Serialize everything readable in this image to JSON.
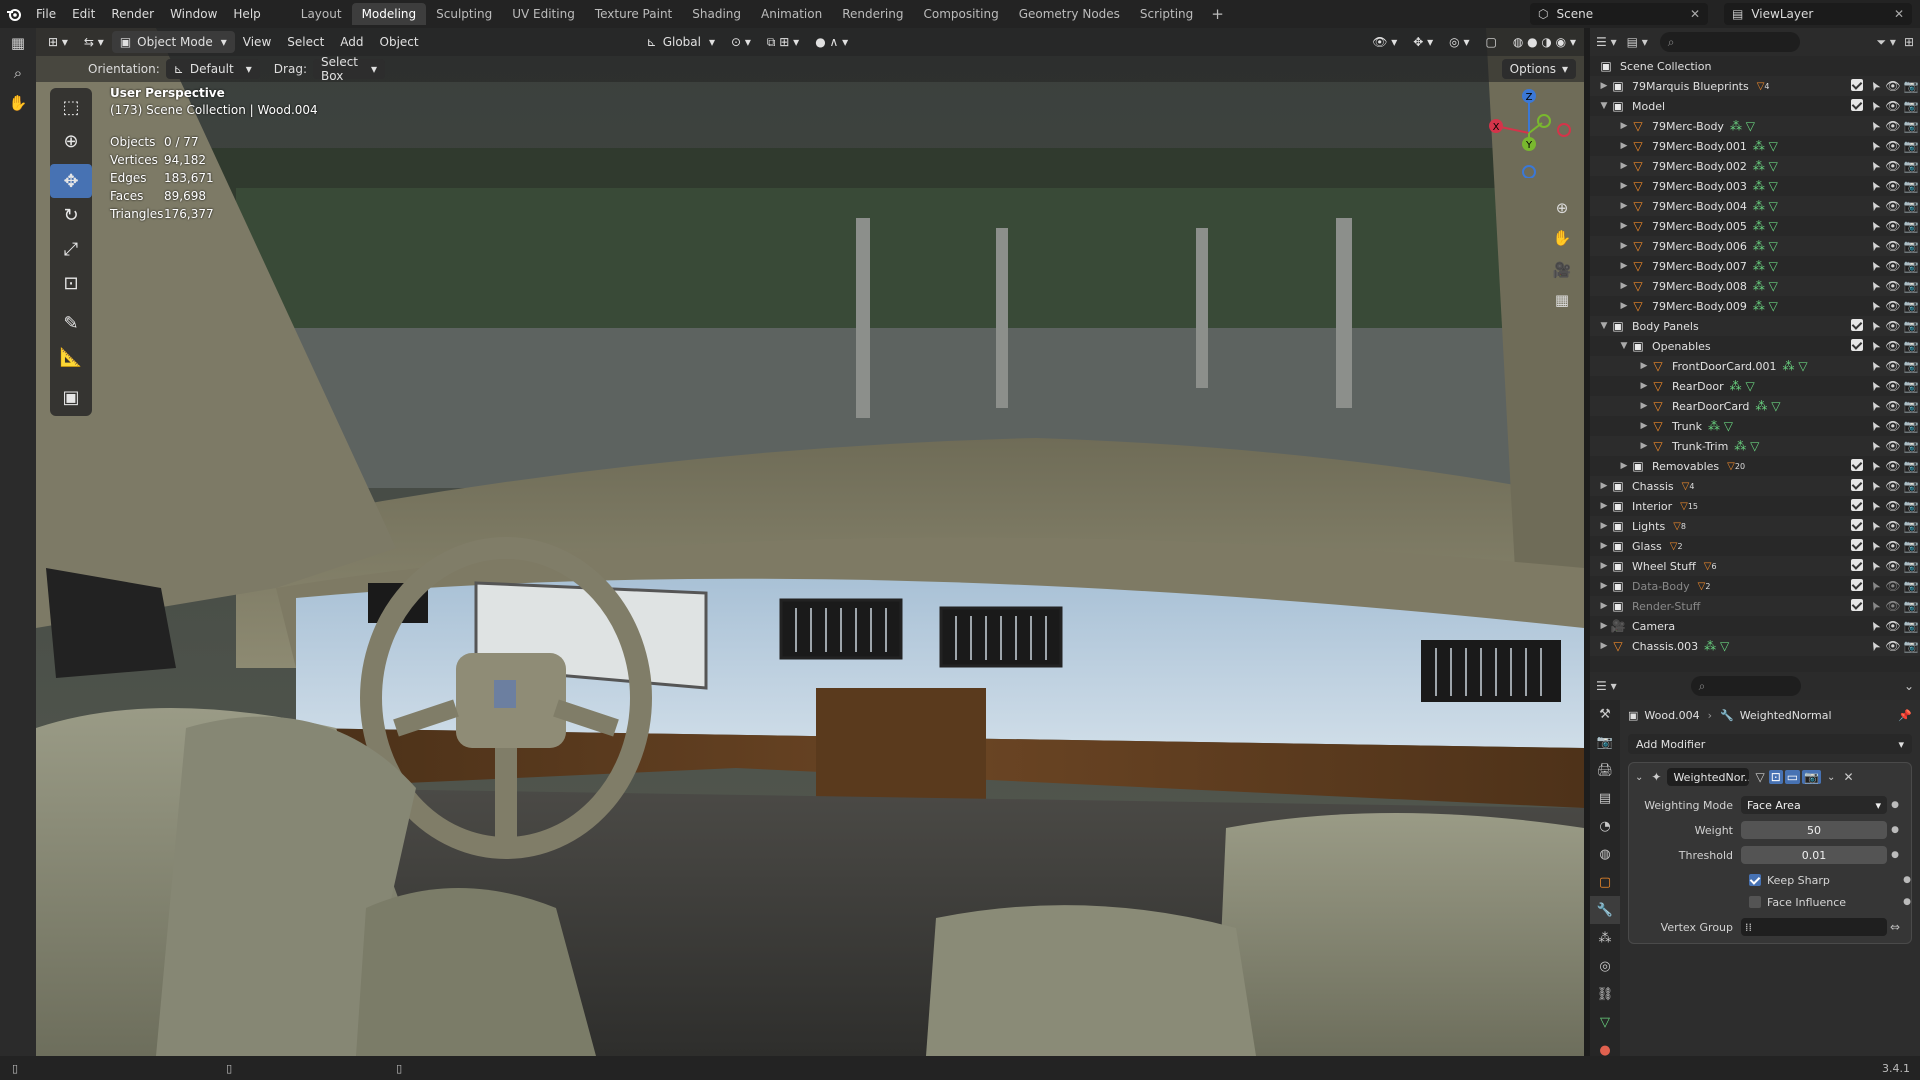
{
  "menu": [
    "File",
    "Edit",
    "Render",
    "Window",
    "Help"
  ],
  "workspaces": [
    "Layout",
    "Modeling",
    "Sculpting",
    "UV Editing",
    "Texture Paint",
    "Shading",
    "Animation",
    "Rendering",
    "Compositing",
    "Geometry Nodes",
    "Scripting"
  ],
  "active_workspace": "Modeling",
  "scene_name": "Scene",
  "view_layer": "ViewLayer",
  "viewport_header": {
    "mode": "Object Mode",
    "menus": [
      "View",
      "Select",
      "Add",
      "Object"
    ],
    "transform": "Global",
    "options": "Options"
  },
  "tool_settings": {
    "orientation_label": "Orientation:",
    "orientation": "Default",
    "drag_label": "Drag:",
    "drag": "Select Box"
  },
  "overlay": {
    "perspective": "User Perspective",
    "collection": "(173) Scene Collection | Wood.004",
    "stats": [
      {
        "k": "Objects",
        "v": "0 / 77"
      },
      {
        "k": "Vertices",
        "v": "94,182"
      },
      {
        "k": "Edges",
        "v": "183,671"
      },
      {
        "k": "Faces",
        "v": "89,698"
      },
      {
        "k": "Triangles",
        "v": "176,377"
      }
    ]
  },
  "gizmo": {
    "z": "Z",
    "y": "Y",
    "x": "X"
  },
  "outliner": {
    "root": "Scene Collection",
    "rows": [
      {
        "name": "79Marquis Blueprints",
        "kind": "collection",
        "depth": 0,
        "open": false,
        "badge": "4"
      },
      {
        "name": "Model",
        "kind": "collection",
        "depth": 0,
        "open": true,
        "badge": ""
      },
      {
        "name": "79Merc-Body",
        "kind": "object",
        "depth": 1,
        "open": false,
        "badge": ""
      },
      {
        "name": "79Merc-Body.001",
        "kind": "object",
        "depth": 1,
        "open": false,
        "badge": ""
      },
      {
        "name": "79Merc-Body.002",
        "kind": "object",
        "depth": 1,
        "open": false,
        "badge": ""
      },
      {
        "name": "79Merc-Body.003",
        "kind": "object",
        "depth": 1,
        "open": false,
        "badge": ""
      },
      {
        "name": "79Merc-Body.004",
        "kind": "object",
        "depth": 1,
        "open": false,
        "badge": ""
      },
      {
        "name": "79Merc-Body.005",
        "kind": "object",
        "depth": 1,
        "open": false,
        "badge": ""
      },
      {
        "name": "79Merc-Body.006",
        "kind": "object",
        "depth": 1,
        "open": false,
        "badge": ""
      },
      {
        "name": "79Merc-Body.007",
        "kind": "object",
        "depth": 1,
        "open": false,
        "badge": ""
      },
      {
        "name": "79Merc-Body.008",
        "kind": "object",
        "depth": 1,
        "open": false,
        "badge": ""
      },
      {
        "name": "79Merc-Body.009",
        "kind": "object",
        "depth": 1,
        "open": false,
        "badge": ""
      },
      {
        "name": "Body Panels",
        "kind": "collection",
        "depth": 0,
        "open": true,
        "badge": ""
      },
      {
        "name": "Openables",
        "kind": "collection",
        "depth": 1,
        "open": true,
        "badge": ""
      },
      {
        "name": "FrontDoorCard.001",
        "kind": "object",
        "depth": 2,
        "open": false,
        "badge": ""
      },
      {
        "name": "RearDoor",
        "kind": "object",
        "depth": 2,
        "open": false,
        "badge": ""
      },
      {
        "name": "RearDoorCard",
        "kind": "object",
        "depth": 2,
        "open": false,
        "badge": ""
      },
      {
        "name": "Trunk",
        "kind": "object",
        "depth": 2,
        "open": false,
        "badge": ""
      },
      {
        "name": "Trunk-Trim",
        "kind": "object",
        "depth": 2,
        "open": false,
        "badge": ""
      },
      {
        "name": "Removables",
        "kind": "collection",
        "depth": 1,
        "open": false,
        "badge": "20"
      },
      {
        "name": "Chassis",
        "kind": "collection",
        "depth": 0,
        "open": false,
        "badge": "4"
      },
      {
        "name": "Interior",
        "kind": "collection",
        "depth": 0,
        "open": false,
        "badge": "15"
      },
      {
        "name": "Lights",
        "kind": "collection",
        "depth": 0,
        "open": false,
        "badge": "8"
      },
      {
        "name": "Glass",
        "kind": "collection",
        "depth": 0,
        "open": false,
        "badge": "2"
      },
      {
        "name": "Wheel Stuff",
        "kind": "collection",
        "depth": 0,
        "open": false,
        "badge": "6"
      },
      {
        "name": "Data-Body",
        "kind": "collection",
        "depth": 0,
        "open": false,
        "badge": "2",
        "dim": true
      },
      {
        "name": "Render-Stuff",
        "kind": "collection",
        "depth": 0,
        "open": false,
        "badge": "",
        "dim": true
      },
      {
        "name": "Camera",
        "kind": "camera",
        "depth": 0,
        "open": false,
        "badge": ""
      },
      {
        "name": "Chassis.003",
        "kind": "object",
        "depth": 0,
        "open": false,
        "badge": ""
      }
    ]
  },
  "properties": {
    "object": "Wood.004",
    "modifier_crumb": "WeightedNormal",
    "add_modifier": "Add Modifier",
    "modifier_name": "WeightedNor...",
    "fields": {
      "weighting_mode_label": "Weighting Mode",
      "weighting_mode": "Face Area",
      "weight_label": "Weight",
      "weight": "50",
      "threshold_label": "Threshold",
      "threshold": "0.01",
      "keep_sharp": "Keep Sharp",
      "face_influence": "Face Influence",
      "vertex_group_label": "Vertex Group"
    }
  },
  "version": "3.4.1",
  "colors": {
    "accent": "#4772b3",
    "object_icon": "#f08a2a",
    "mesh_icon": "#69d17f"
  }
}
